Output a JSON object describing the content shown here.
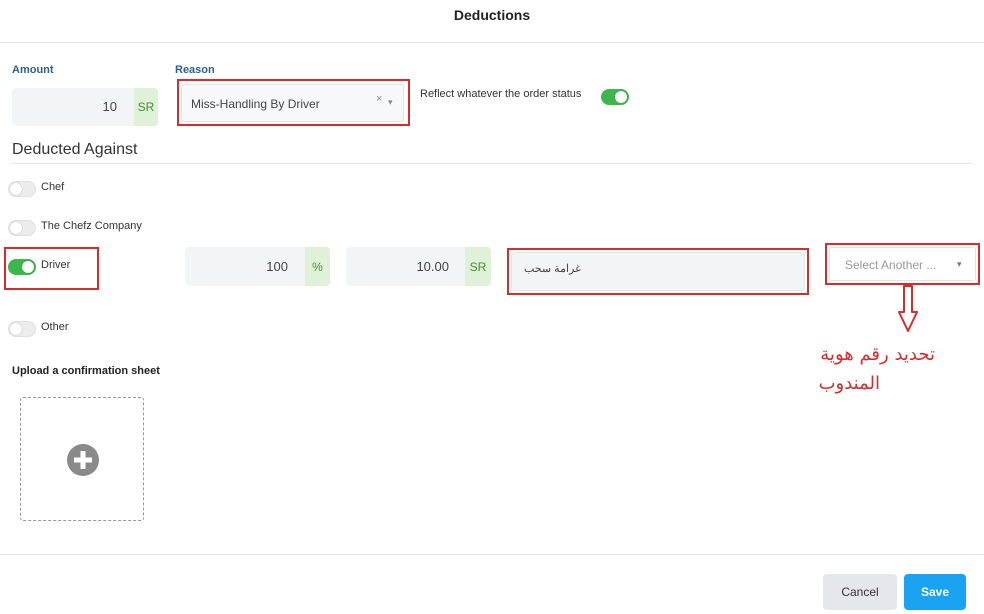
{
  "modal": {
    "title": "Deductions"
  },
  "amount": {
    "label": "Amount",
    "value": "10",
    "currency": "SR"
  },
  "reason": {
    "label": "Reason",
    "value": "Miss-Handling By Driver",
    "clear": "×",
    "caret": "▾"
  },
  "reflect": {
    "label": "Reflect whatever the order status",
    "on": true
  },
  "deducted_against": {
    "title": "Deducted Against",
    "options": [
      {
        "label": "Chef",
        "on": false
      },
      {
        "label": "The Chefz Company",
        "on": false
      },
      {
        "label": "Driver",
        "on": true
      },
      {
        "label": "Other",
        "on": false
      }
    ]
  },
  "driver_row": {
    "percent_value": "100",
    "percent_unit": "%",
    "amount_value": "10.00",
    "amount_currency": "SR",
    "note": "غرامة سحب",
    "select_placeholder": "Select Another ...",
    "select_caret": "▾"
  },
  "annotation": {
    "line1": "تحديد رقم هوية",
    "line2": "المندوب",
    "color": "#d62c2c"
  },
  "upload": {
    "label": "Upload a confirmation sheet"
  },
  "footer": {
    "cancel": "Cancel",
    "save": "Save"
  },
  "colors": {
    "accent": "#1aa3f0",
    "toggle_on": "#3cb84a",
    "highlight": "#d62c2c"
  }
}
